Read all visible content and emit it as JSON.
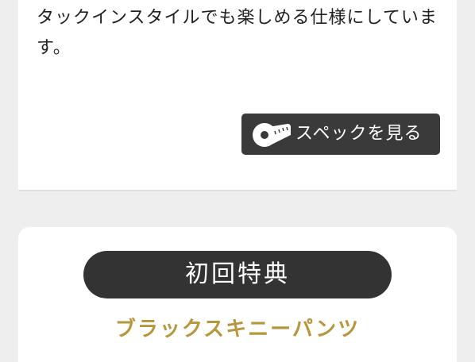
{
  "product_card": {
    "description_lines": [
      "タックインスタイルでも楽しめる仕様にしていま",
      "す。"
    ],
    "spec_button": {
      "label": "スペックを見る",
      "icon": "tape-measure-icon"
    }
  },
  "bonus_card": {
    "badge_label": "初回特典",
    "product_name": "ブラックスキニーパンツ"
  },
  "colors": {
    "page_background": "#eeeeee",
    "card_background": "#ffffff",
    "dark_fill": "#333333",
    "accent_gold": "#b8963c"
  }
}
